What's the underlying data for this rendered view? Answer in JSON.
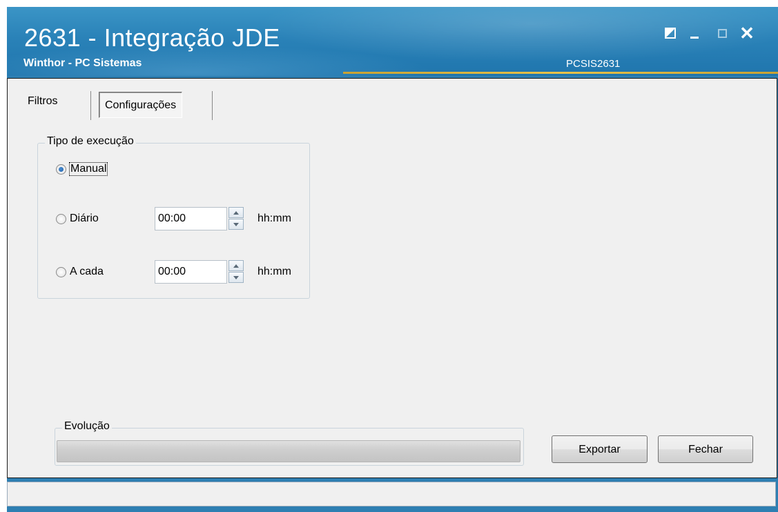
{
  "window": {
    "title": "2631 - Integração JDE",
    "subtitle": "Winthor - PC Sistemas",
    "program_code": "PCSIS2631",
    "controls": {
      "restore_icon": "restore-split-icon",
      "minimize_icon": "minimize-icon",
      "maximize_icon": "maximize-icon",
      "close_glyph": "✕"
    }
  },
  "tabs": [
    {
      "label": "Filtros",
      "active": false
    },
    {
      "label": "Configurações",
      "active": true
    }
  ],
  "execution": {
    "legend": "Tipo de execução",
    "options": [
      {
        "label": "Manual",
        "checked": true
      },
      {
        "label": "Diário",
        "checked": false,
        "time": "00:00",
        "unit": "hh:mm"
      },
      {
        "label": "A cada",
        "checked": false,
        "time": "00:00",
        "unit": "hh:mm"
      }
    ]
  },
  "progress": {
    "legend": "Evolução",
    "percent": 0
  },
  "buttons": {
    "export": "Exportar",
    "close": "Fechar"
  },
  "colors": {
    "titlebar": "#2a82b8",
    "accent_underline": "#e8c24a",
    "client_bg": "#f0f0f0"
  }
}
